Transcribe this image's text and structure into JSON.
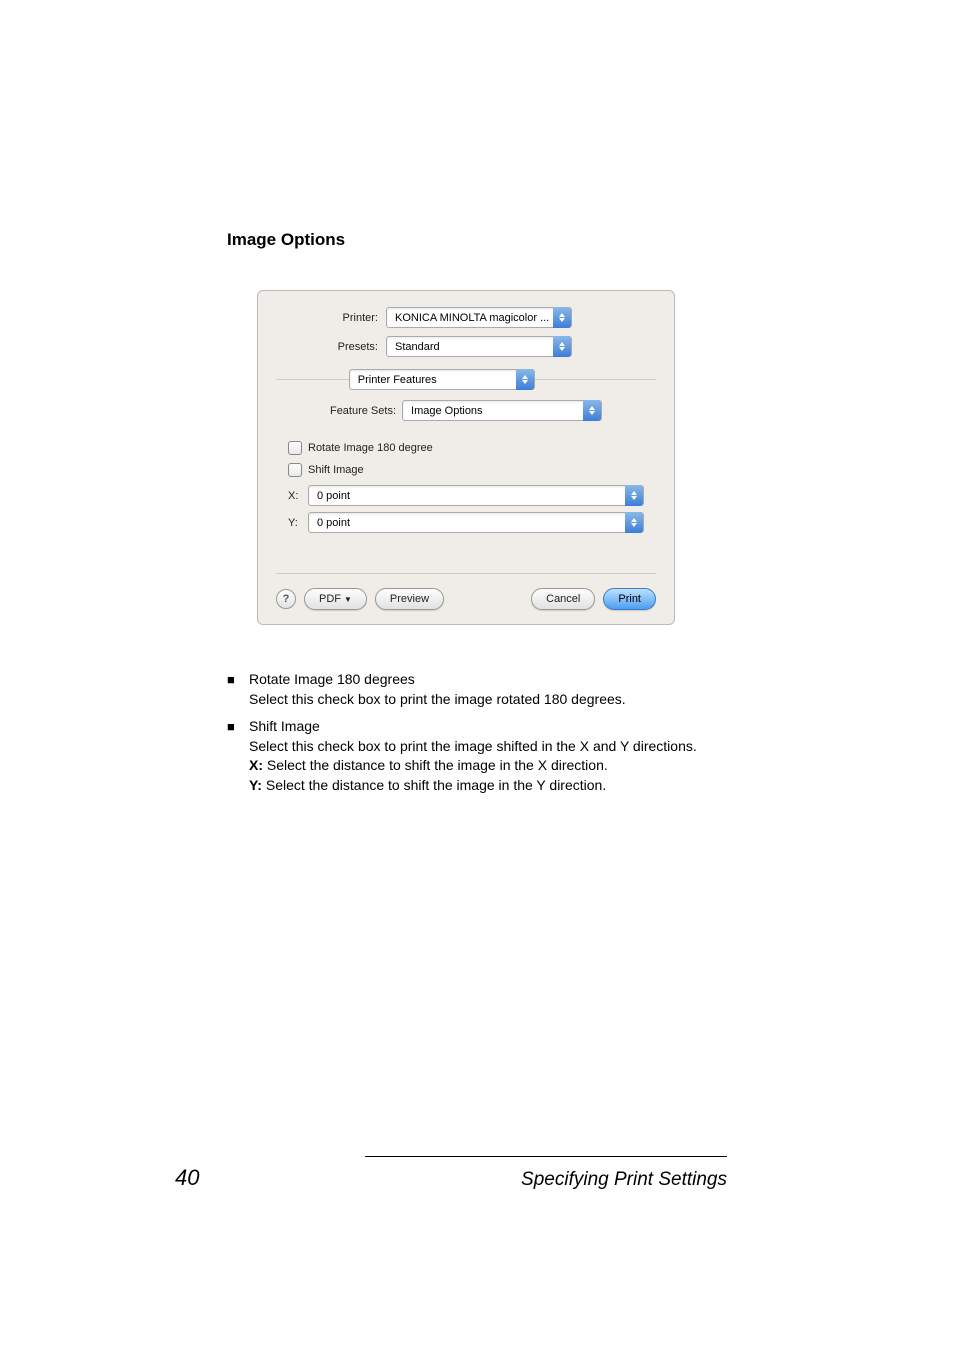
{
  "heading": "Image Options",
  "dialog": {
    "printerLabel": "Printer:",
    "printerValue": "KONICA MINOLTA magicolor ...",
    "presetsLabel": "Presets:",
    "presetsValue": "Standard",
    "paneValue": "Printer Features",
    "featureSetsLabel": "Feature Sets:",
    "featureSetsValue": "Image Options",
    "rotateLabel": "Rotate Image 180 degree",
    "shiftLabel": "Shift Image",
    "xLabel": "X:",
    "xValue": "0 point",
    "yLabel": "Y:",
    "yValue": "0 point",
    "helpLabel": "?",
    "pdfLabel": "PDF",
    "previewLabel": "Preview",
    "cancelLabel": "Cancel",
    "printLabel": "Print"
  },
  "bullets": [
    {
      "title": "Rotate Image 180 degrees",
      "lines": [
        {
          "prefix": "",
          "text": "Select this check box to print the image rotated 180 degrees."
        }
      ]
    },
    {
      "title": "Shift Image",
      "lines": [
        {
          "prefix": "",
          "text": "Select this check box to print the image shifted in the X and Y directions."
        },
        {
          "prefix": "X: ",
          "text": "Select the distance to shift the image in the X direction."
        },
        {
          "prefix": "Y: ",
          "text": "Select the distance to shift the image in the Y direction."
        }
      ]
    }
  ],
  "footer": {
    "pageNumber": "40",
    "section": "Specifying Print Settings"
  }
}
